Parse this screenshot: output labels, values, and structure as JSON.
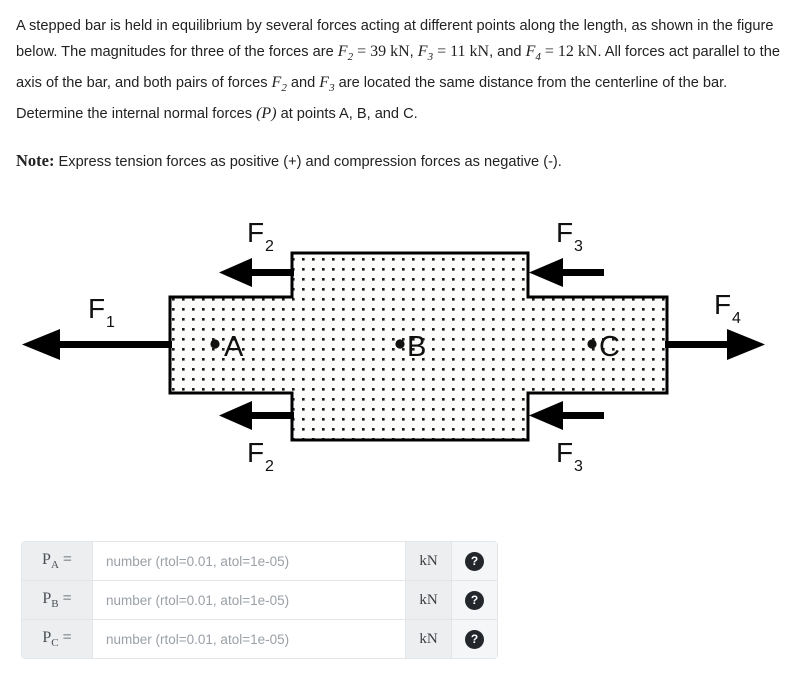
{
  "problem": {
    "sentence1_part1": "A stepped bar is held in equilibrium by several forces acting at different points along the length, as shown in the figure below. The magnitudes for three of the forces are ",
    "f2_symbol": "F",
    "f2_sub": "2",
    "eq": "=",
    "f2_value": "39 kN",
    "comma1": ", ",
    "f3_symbol": "F",
    "f3_sub": "3",
    "f3_value": "11 kN",
    "comma2": ", and ",
    "f4_symbol": "F",
    "f4_sub": "4",
    "f4_value": "12 kN",
    "sentence1_part2": ". All forces act parallel to the axis of the bar, and both pairs of forces ",
    "sentence1_part3": " and ",
    "sentence1_part4": " are located the same distance from the centerline of the bar. Determine the internal normal forces ",
    "p_symbol": "(P)",
    "sentence1_part5": " at points A, B, and C.",
    "note_label": "Note:",
    "note_text": " Express tension forces as positive (+) and compression forces as negative (-)."
  },
  "figure": {
    "labels": {
      "f1": "F",
      "f1_sub": "1",
      "f2_top": "F",
      "f2_top_sub": "2",
      "f2_bottom": "F",
      "f2_bottom_sub": "2",
      "f3_top": "F",
      "f3_top_sub": "3",
      "f3_bottom": "F",
      "f3_bottom_sub": "3",
      "f4": "F",
      "f4_sub": "4",
      "point_a": "A",
      "point_b": "B",
      "point_c": "C"
    },
    "colors": {
      "outline": "#000000",
      "hatch_dot": "#1a1a1a",
      "fill": "#fdfdfb",
      "arrow": "#000000"
    },
    "arrow_directions": {
      "f1": "left",
      "f2_top": "left",
      "f2_bottom": "left",
      "f3_top": "left",
      "f3_bottom": "left",
      "f4": "right"
    }
  },
  "answers": {
    "rows": [
      {
        "label": "P",
        "sub": "A",
        "eq": "=",
        "placeholder": "number (rtol=0.01, atol=1e-05)",
        "unit": "kN",
        "help": "?"
      },
      {
        "label": "P",
        "sub": "B",
        "eq": "=",
        "placeholder": "number (rtol=0.01, atol=1e-05)",
        "unit": "kN",
        "help": "?"
      },
      {
        "label": "P",
        "sub": "C",
        "eq": "=",
        "placeholder": "number (rtol=0.01, atol=1e-05)",
        "unit": "kN",
        "help": "?"
      }
    ]
  }
}
